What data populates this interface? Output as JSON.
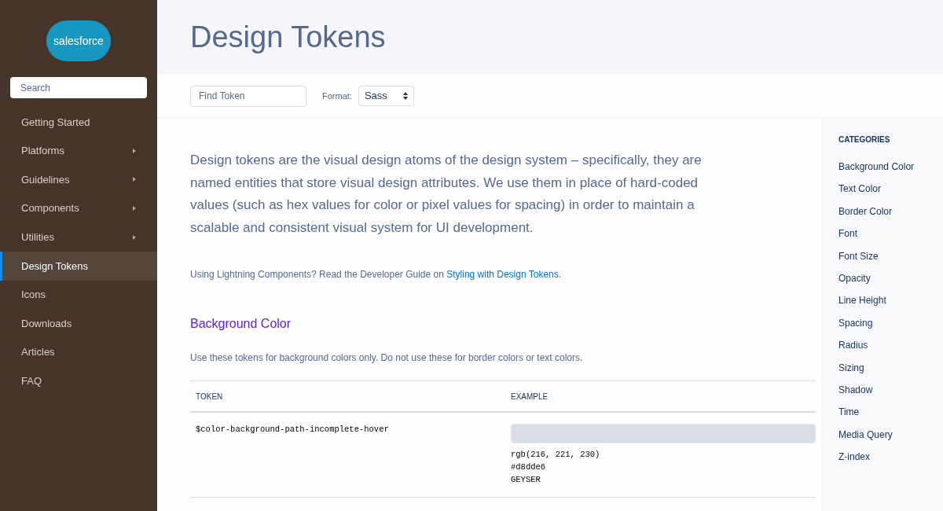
{
  "sidebar": {
    "logo": "salesforce",
    "search": {
      "placeholder": "Search"
    },
    "items": [
      {
        "label": "Getting Started",
        "selected": false,
        "has_submenu": false
      },
      {
        "label": "Platforms",
        "selected": false,
        "has_submenu": true
      },
      {
        "label": "Guidelines",
        "selected": false,
        "has_submenu": true
      },
      {
        "label": "Components",
        "selected": false,
        "has_submenu": true
      },
      {
        "label": "Utilities",
        "selected": false,
        "has_submenu": true
      },
      {
        "label": "Design Tokens",
        "selected": true,
        "has_submenu": false
      },
      {
        "label": "Icons",
        "selected": false,
        "has_submenu": false
      },
      {
        "label": "Downloads",
        "selected": false,
        "has_submenu": false
      },
      {
        "label": "Articles",
        "selected": false,
        "has_submenu": false
      },
      {
        "label": "FAQ",
        "selected": false,
        "has_submenu": false
      }
    ]
  },
  "page_title": "Design Tokens",
  "toolbar": {
    "find": {
      "placeholder": "Find Token"
    },
    "format_label": "Format:",
    "format_value": "Sass"
  },
  "intro": "Design tokens are the visual design atoms of the design system – specifically, they are named entities that store visual design attributes. We use them in place of hard-coded values (such as hex values for color or pixel values for spacing) in order to maintain a scalable and consistent visual system for UI development.",
  "note": {
    "text": "Using Lightning Components? Read the Developer Guide on ",
    "link": "Styling with Design Tokens",
    "after": "."
  },
  "section": {
    "title": "Background Color",
    "description": "Use these tokens for background colors only. Do not use these for border colors or text colors.",
    "table": {
      "columns": [
        "TOKEN",
        "EXAMPLE"
      ],
      "rows": [
        {
          "token": "$color-background-path-incomplete-hover",
          "color": "#d8dde6",
          "rgb": "rgb(216, 221, 230)",
          "hex": "#d8dde6",
          "name": "GEYSER"
        }
      ]
    }
  },
  "categories": {
    "title": "CATEGORIES",
    "items": [
      "Background Color",
      "Text Color",
      "Border Color",
      "Font",
      "Font Size",
      "Opacity",
      "Line Height",
      "Spacing",
      "Radius",
      "Sizing",
      "Shadow",
      "Time",
      "Media Query",
      "Z-index"
    ]
  }
}
